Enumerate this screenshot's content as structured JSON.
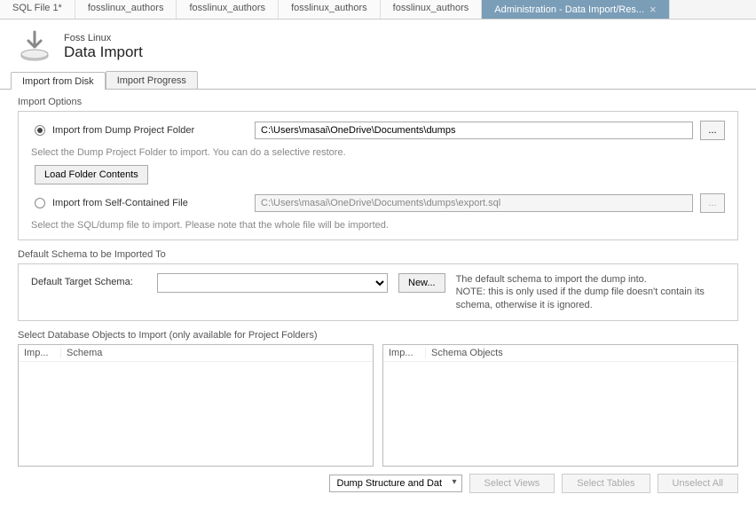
{
  "topTabs": [
    {
      "label": "SQL File 1*",
      "active": false
    },
    {
      "label": "fosslinux_authors",
      "active": false
    },
    {
      "label": "fosslinux_authors",
      "active": false
    },
    {
      "label": "fosslinux_authors",
      "active": false
    },
    {
      "label": "fosslinux_authors",
      "active": false
    },
    {
      "label": "Administration - Data Import/Res...",
      "active": true
    }
  ],
  "header": {
    "subtitle": "Foss Linux",
    "title": "Data Import"
  },
  "subTabs": [
    {
      "label": "Import from Disk",
      "active": true
    },
    {
      "label": "Import Progress",
      "active": false
    }
  ],
  "importOptions": {
    "legend": "Import Options",
    "dumpFolder": {
      "label": "Import from Dump Project Folder",
      "path": "C:\\Users\\masai\\OneDrive\\Documents\\dumps",
      "checked": true,
      "browse": "..."
    },
    "dumpFolderHint": "Select the Dump Project Folder to import. You can do a selective restore.",
    "loadFolderBtn": "Load Folder Contents",
    "selfContained": {
      "label": "Import from Self-Contained File",
      "path": "C:\\Users\\masai\\OneDrive\\Documents\\dumps\\export.sql",
      "checked": false,
      "browse": "..."
    },
    "selfContainedHint": "Select the SQL/dump file to import. Please note that the whole file will be imported."
  },
  "defaultSchema": {
    "legend": "Default Schema to be Imported To",
    "label": "Default Target Schema:",
    "newBtn": "New...",
    "desc": "The default schema to import the dump into.\nNOTE: this is only used if the dump file doesn't contain its schema, otherwise it is ignored."
  },
  "objects": {
    "legend": "Select Database Objects to Import (only available for Project Folders)",
    "leftCols": {
      "c1": "Imp...",
      "c2": "Schema"
    },
    "rightCols": {
      "c1": "Imp...",
      "c2": "Schema Objects"
    }
  },
  "bottom": {
    "dumpType": "Dump Structure and Dat",
    "selectViews": "Select Views",
    "selectTables": "Select Tables",
    "unselectAll": "Unselect All"
  }
}
